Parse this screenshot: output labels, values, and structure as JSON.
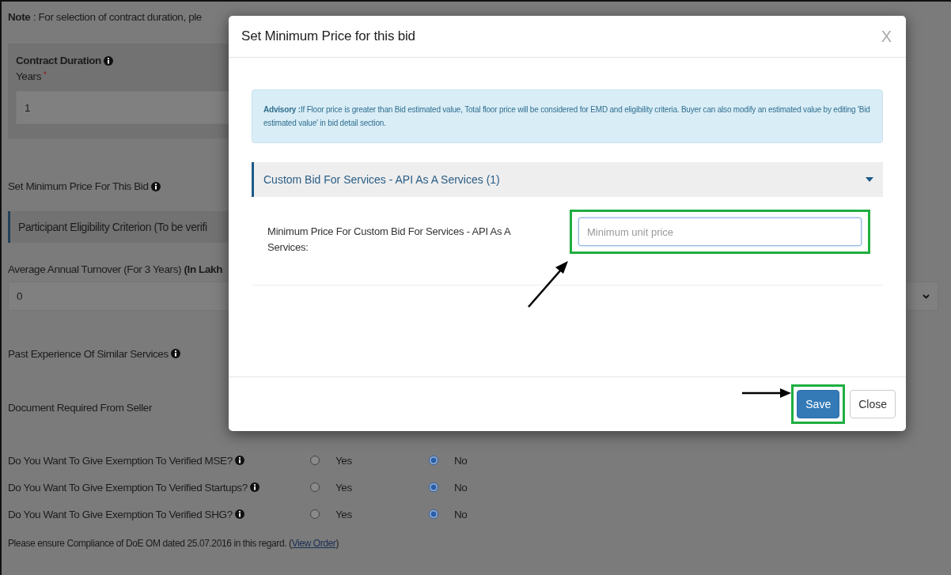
{
  "page": {
    "note": "**Note** : For selection of contract duration, ple",
    "contract_duration": {
      "title": "Contract Duration",
      "info_icon": true,
      "field_label": "Years",
      "required_mark": "*",
      "value": "1"
    },
    "min_price_label": {
      "text": "Set Minimum Price For This Bid",
      "info_icon": true
    },
    "section_title": "Participant Eligibility Criterion (To be verifi",
    "turnover": {
      "label": "Average Annual Turnover (For 3 Years) **(In Lakh**",
      "value": "0"
    },
    "labels": [
      {
        "text": "Past Experience Of Similar Services",
        "info_icon": true
      },
      {
        "text": "Document Required From Seller",
        "info_icon": false
      }
    ],
    "exemptions": [
      {
        "question": "Do You Want To Give Exemption To Verified MSE?",
        "info_icon": true,
        "options": [
          {
            "label": "Yes",
            "selected": false
          },
          {
            "label": "No",
            "selected": true
          }
        ]
      },
      {
        "question": "Do You Want To Give Exemption To Verified Startups?",
        "info_icon": true,
        "options": [
          {
            "label": "Yes",
            "selected": false
          },
          {
            "label": "No",
            "selected": true
          }
        ]
      },
      {
        "question": "Do You Want To Give Exemption To Verified SHG?",
        "info_icon": true,
        "options": [
          {
            "label": "Yes",
            "selected": false
          },
          {
            "label": "No",
            "selected": true
          }
        ]
      }
    ],
    "compliance": {
      "text": "Please ensure Compliance of DoE OM dated 25.07.2016 in this regard. (",
      "link": "View Order",
      "after": ")"
    }
  },
  "modal": {
    "title": "Set Minimum Price for this bid",
    "close": "X",
    "advisory": "**Advisory :**If Floor price is greater than Bid estimated value, Total floor price will be considered for EMD and eligibility criteria. Buyer can also modify an estimated value by editing 'Bid estimated value' in bid detail section.",
    "accordion": {
      "title": "Custom Bid For Services - API As A Services  (1)",
      "expanded": true,
      "field": {
        "label": "Minimum Price For Custom Bid For Services - API As A Services:",
        "placeholder": "Minimum unit price",
        "highlighted": true
      }
    },
    "buttons": [
      {
        "label": "Save",
        "kind": "primary",
        "highlighted": true
      },
      {
        "label": "Close",
        "kind": "default",
        "highlighted": false
      }
    ]
  }
}
